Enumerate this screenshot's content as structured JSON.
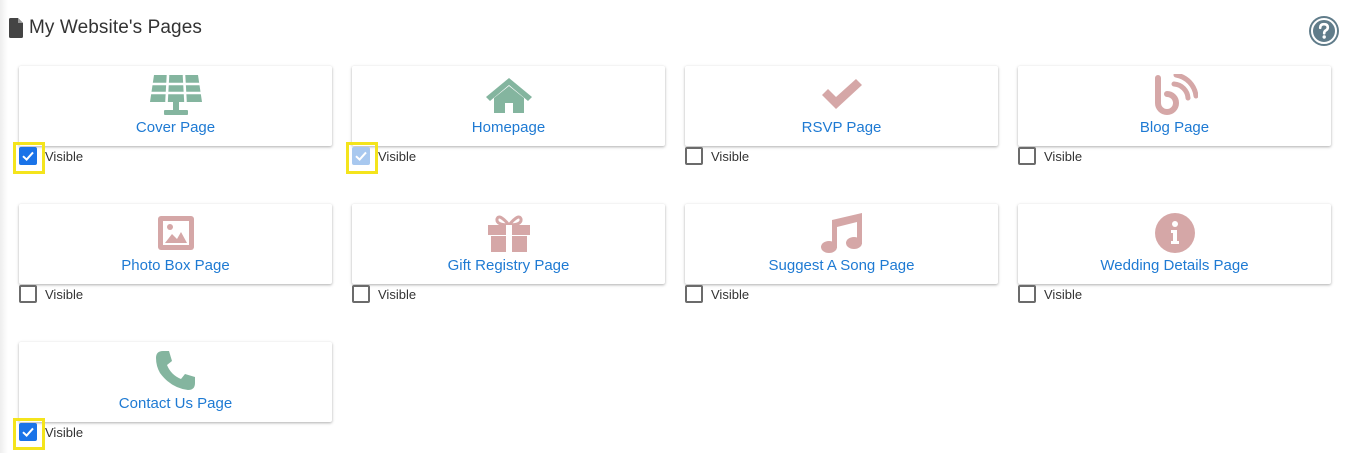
{
  "header": {
    "title": "My Website's Pages",
    "icon": "document-icon"
  },
  "help": {
    "icon": "help-circle-icon"
  },
  "colors": {
    "green": "#84b59f",
    "rose": "#d5a7a7",
    "link": "#1e7ad3",
    "check": "#1a73e8",
    "highlight": "#f4e41c"
  },
  "pages": [
    {
      "label": "Cover Page",
      "icon": "solar-panel-icon",
      "visible_label": "Visible",
      "checked": true,
      "highlighted": true
    },
    {
      "label": "Homepage",
      "icon": "home-icon",
      "visible_label": "Visible",
      "checked": true,
      "disabled": true,
      "highlighted": true
    },
    {
      "label": "RSVP Page",
      "icon": "checkmark-icon",
      "visible_label": "Visible",
      "checked": false
    },
    {
      "label": "Blog Page",
      "icon": "blog-rss-icon",
      "visible_label": "Visible",
      "checked": false
    },
    {
      "label": "Photo Box Page",
      "icon": "image-icon",
      "visible_label": "Visible",
      "checked": false
    },
    {
      "label": "Gift Registry Page",
      "icon": "gift-icon",
      "visible_label": "Visible",
      "checked": false
    },
    {
      "label": "Suggest A Song Page",
      "icon": "music-note-icon",
      "visible_label": "Visible",
      "checked": false
    },
    {
      "label": "Wedding Details Page",
      "icon": "info-icon",
      "visible_label": "Visible",
      "checked": false
    },
    {
      "label": "Contact Us Page",
      "icon": "phone-icon",
      "visible_label": "Visible",
      "checked": true,
      "highlighted": true
    }
  ]
}
